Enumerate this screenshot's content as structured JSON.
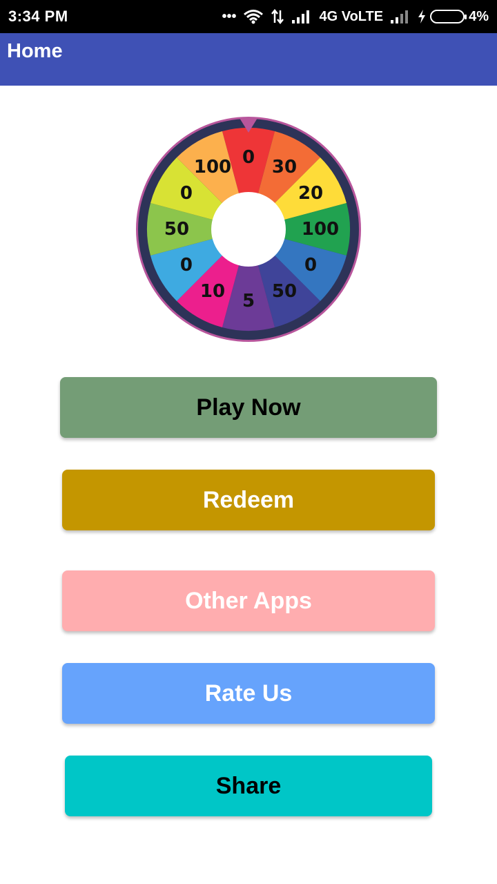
{
  "status_bar": {
    "time": "3:34 PM",
    "dots": "•••",
    "network": "4G VoLTE",
    "battery": "4%"
  },
  "app_bar": {
    "title": "Home"
  },
  "wheel": {
    "slices": [
      {
        "label": "0",
        "color": "#ee3537"
      },
      {
        "label": "30",
        "color": "#f36c36"
      },
      {
        "label": "20",
        "color": "#fedc39"
      },
      {
        "label": "100",
        "color": "#21a250"
      },
      {
        "label": "0",
        "color": "#3476c0"
      },
      {
        "label": "50",
        "color": "#3f4499"
      },
      {
        "label": "5",
        "color": "#6c3b97"
      },
      {
        "label": "10",
        "color": "#ec1f8d"
      },
      {
        "label": "0",
        "color": "#3eaae1"
      },
      {
        "label": "50",
        "color": "#8cc54c"
      },
      {
        "label": "0",
        "color": "#d8e234"
      },
      {
        "label": "100",
        "color": "#fcb04d"
      }
    ],
    "rim_color": "#2d3358",
    "outline_color": "#b8569c",
    "pointer_color": "#b8569c",
    "center_color": "#ffffff"
  },
  "buttons": {
    "play": "Play Now",
    "redeem": "Redeem",
    "other_apps": "Other Apps",
    "rate_us": "Rate Us",
    "share": "Share"
  }
}
